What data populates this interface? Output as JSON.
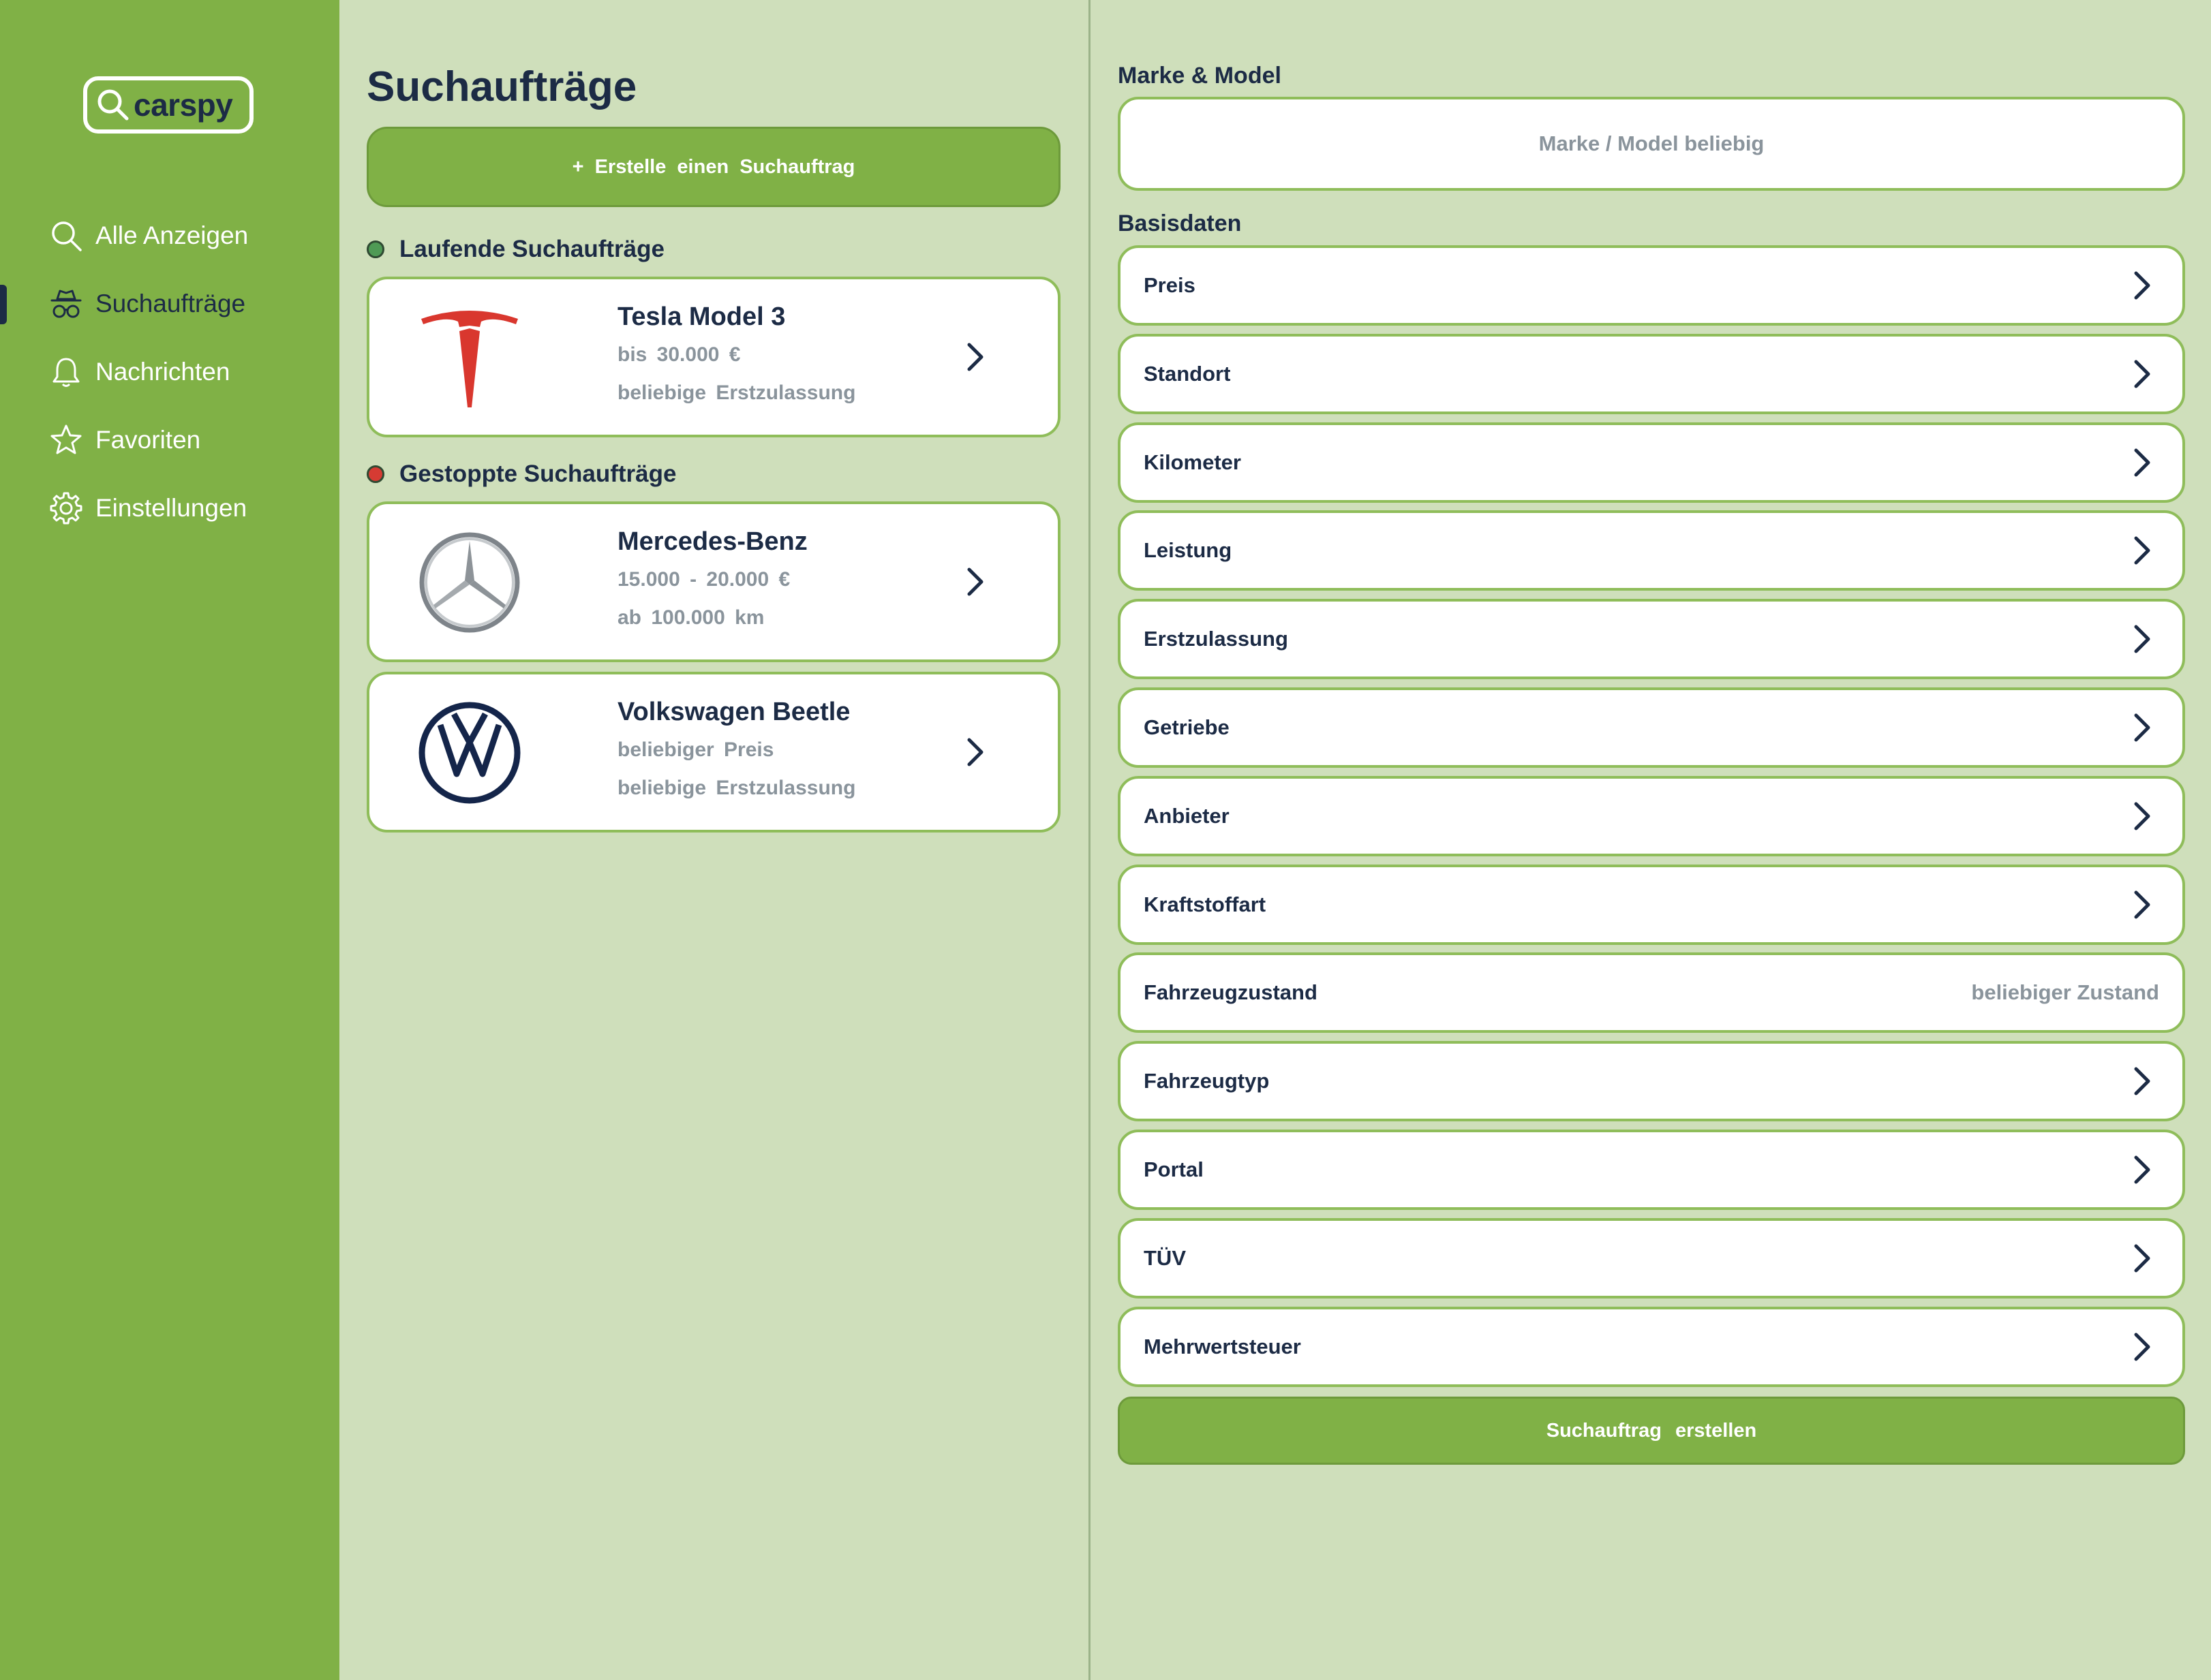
{
  "app": {
    "logo_text": "carspy"
  },
  "colors": {
    "sidebar": "#80b146",
    "background": "#cfdfbb",
    "navy": "#1c2b45",
    "running": "#4f9a55",
    "stopped": "#d63b33"
  },
  "sidebar": {
    "items": [
      {
        "label": "Alle Anzeigen",
        "icon": "search-icon"
      },
      {
        "label": "Suchaufträge",
        "icon": "spy-icon",
        "active": true
      },
      {
        "label": "Nachrichten",
        "icon": "bell-icon"
      },
      {
        "label": "Favoriten",
        "icon": "star-icon"
      },
      {
        "label": "Einstellungen",
        "icon": "gear-icon"
      }
    ]
  },
  "main": {
    "title": "Suchaufträge",
    "create_button": "+ Erstelle einen Suchauftrag",
    "running": {
      "title": "Laufende Suchaufträge",
      "items": [
        {
          "title": "Tesla Model 3",
          "line1": "bis 30.000 €",
          "line2": "beliebige Erstzulassung",
          "logo": "tesla-logo"
        }
      ]
    },
    "stopped": {
      "title": "Gestoppte Suchaufträge",
      "items": [
        {
          "title": "Mercedes-Benz",
          "line1": "15.000 - 20.000 €",
          "line2": "ab 100.000 km",
          "logo": "mercedes-logo"
        },
        {
          "title": "Volkswagen Beetle",
          "line1": "beliebiger Preis",
          "line2": "beliebige Erstzulassung",
          "logo": "vw-logo"
        }
      ]
    }
  },
  "form": {
    "brand_label": "Marke & Model",
    "brand_placeholder": "Marke / Model beliebig",
    "basis_label": "Basisdaten",
    "fields": [
      {
        "label": "Preis"
      },
      {
        "label": "Standort"
      },
      {
        "label": "Kilometer"
      },
      {
        "label": "Leistung"
      },
      {
        "label": "Erstzulassung"
      },
      {
        "label": "Getriebe"
      },
      {
        "label": "Anbieter"
      },
      {
        "label": "Kraftstoffart"
      },
      {
        "label": "Fahrzeugzustand",
        "value": "beliebiger Zustand"
      },
      {
        "label": "Fahrzeugtyp"
      },
      {
        "label": "Portal"
      },
      {
        "label": "TÜV"
      },
      {
        "label": "Mehrwertsteuer"
      }
    ],
    "submit": "Suchauftrag erstellen"
  }
}
